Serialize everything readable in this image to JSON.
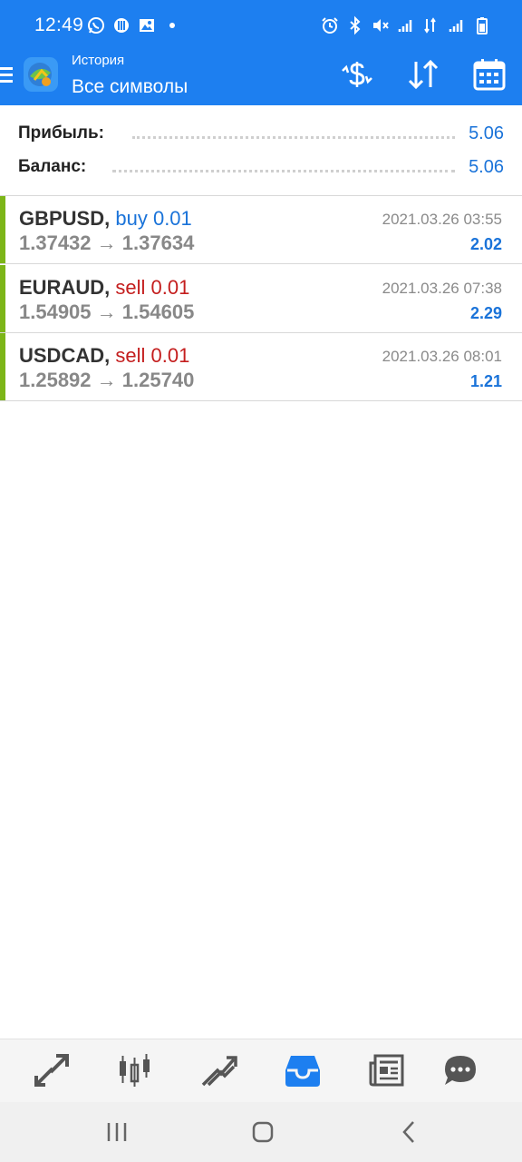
{
  "status_bar": {
    "time": "12:49",
    "left_icons": [
      "whatsapp-icon",
      "vpn-icon",
      "image-icon",
      "dot-icon"
    ],
    "right_icons": [
      "alarm-icon",
      "bluetooth-icon",
      "mute-icon",
      "signal-icon",
      "data-icon",
      "signal-icon",
      "battery-icon"
    ]
  },
  "app_bar": {
    "subtitle": "История",
    "title": "Все символы",
    "actions": [
      "currency-exchange-icon",
      "sort-icon",
      "calendar-icon"
    ]
  },
  "summary": {
    "profit_label": "Прибыль:",
    "profit_value": "5.06",
    "balance_label": "Баланс:",
    "balance_value": "5.06"
  },
  "trades": [
    {
      "symbol": "GBPUSD,",
      "side": "buy 0.01",
      "open": "1.37432",
      "arrow": "→",
      "close": "1.37634",
      "date": "2021.03.26 03:55",
      "profit": "2.02"
    },
    {
      "symbol": "EURAUD,",
      "side": "sell 0.01",
      "open": "1.54905",
      "arrow": "→",
      "close": "1.54605",
      "date": "2021.03.26 07:38",
      "profit": "2.29"
    },
    {
      "symbol": "USDCAD,",
      "side": "sell 0.01",
      "open": "1.25892",
      "arrow": "→",
      "close": "1.25740",
      "date": "2021.03.26 08:01",
      "profit": "1.21"
    }
  ],
  "bottom_nav": {
    "items": [
      "quotes-icon",
      "chart-icon",
      "trade-icon",
      "history-icon",
      "news-icon",
      "chat-icon"
    ],
    "active": "history-icon",
    "active_color": "#1d7ff0",
    "inactive_color": "#555555"
  },
  "system_nav": [
    "recents-icon",
    "home-icon",
    "back-icon"
  ],
  "colors": {
    "primary": "#1d7ff0",
    "buy": "#1a73d9",
    "sell": "#c41e1e",
    "profit_bar": "#7cb518"
  }
}
